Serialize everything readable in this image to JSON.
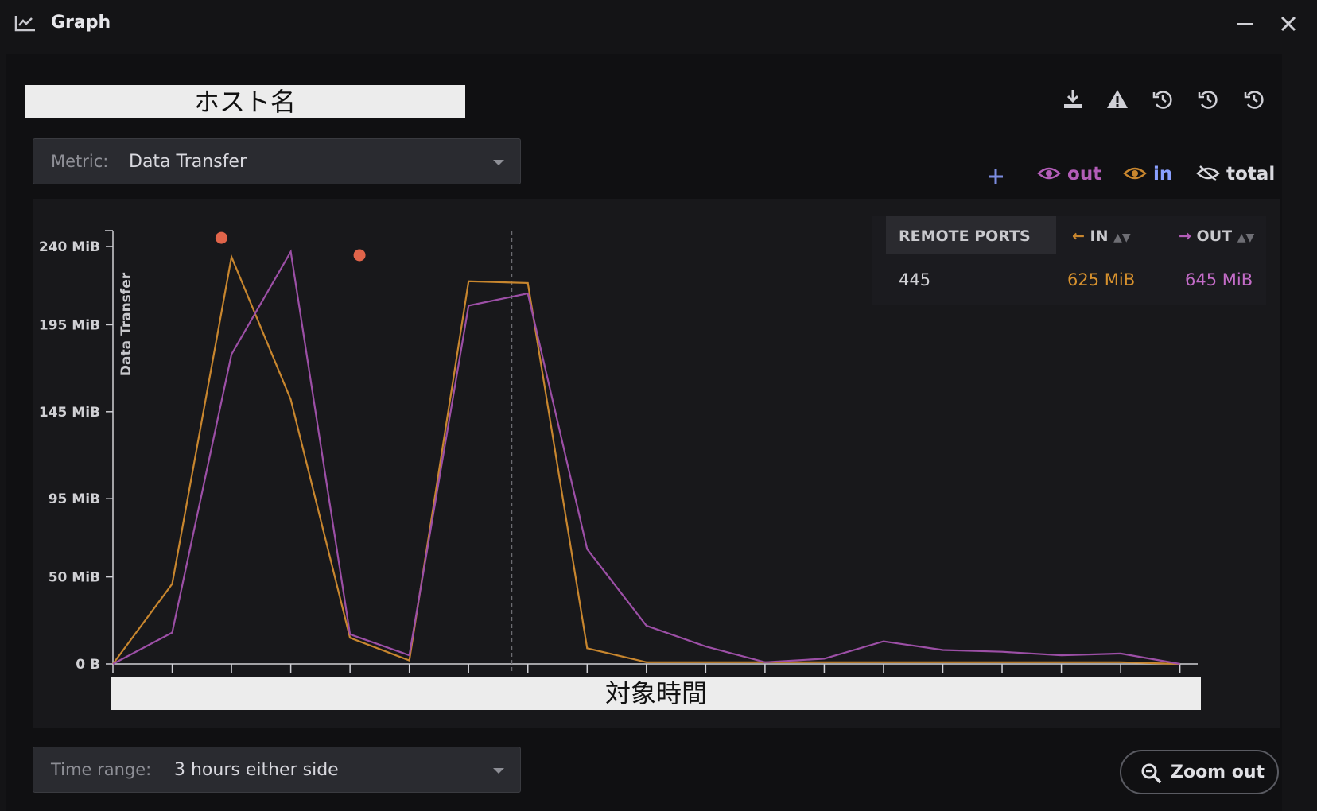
{
  "window": {
    "title": "Graph",
    "minimize_icon": "minimize-icon",
    "close_icon": "close-icon"
  },
  "header": {
    "host_label": "ホスト名"
  },
  "toolbar": {
    "icons": [
      "download-icon",
      "warning-icon",
      "history-icon",
      "history-icon",
      "history-icon"
    ]
  },
  "metric": {
    "label": "Metric:",
    "value": "Data Transfer"
  },
  "legend": {
    "add_icon": "plus-icon",
    "items": [
      {
        "label": "out",
        "icon": "eye-icon",
        "color": "#b35db8"
      },
      {
        "label": "in",
        "icon": "eye-icon",
        "color": "#c8862e"
      },
      {
        "label": "total",
        "icon": "eye-off-icon",
        "color": "#d8d8de"
      }
    ]
  },
  "ports_table": {
    "headers": {
      "ports": "REMOTE PORTS",
      "in": "IN",
      "out": "OUT"
    },
    "rows": [
      {
        "port": "445",
        "in": "625 MiB",
        "out": "645 MiB"
      }
    ]
  },
  "chart_data": {
    "type": "line",
    "ylabel": "Data Transfer",
    "xlabel": "対象時間",
    "ylim": [
      0,
      240
    ],
    "yticks": [
      {
        "value": 0,
        "label": "0 B"
      },
      {
        "value": 50,
        "label": "50 MiB"
      },
      {
        "value": 95,
        "label": "95 MiB"
      },
      {
        "value": 145,
        "label": "145 MiB"
      },
      {
        "value": 195,
        "label": "195 MiB"
      },
      {
        "value": 240,
        "label": "240 MiB"
      }
    ],
    "x": [
      0,
      1,
      2,
      3,
      4,
      5,
      6,
      7,
      8,
      9,
      10,
      11,
      12,
      13,
      14,
      15,
      16,
      17,
      18
    ],
    "xlim": [
      0,
      18.3
    ],
    "marker_x": 6.73,
    "series": [
      {
        "name": "in",
        "color": "#c8862e",
        "values": [
          0,
          46,
          234,
          152,
          15,
          2,
          220,
          219,
          9,
          1,
          1,
          1,
          1,
          1,
          1,
          1,
          1,
          1,
          0
        ]
      },
      {
        "name": "out",
        "color": "#9c4fa6",
        "values": [
          0,
          18,
          178,
          237,
          17,
          5,
          206,
          213,
          66,
          22,
          10,
          1,
          3,
          13,
          8,
          7,
          5,
          6,
          0
        ]
      }
    ],
    "alerts": [
      {
        "x": 1.83,
        "y": 245
      },
      {
        "x": 4.16,
        "y": 235
      }
    ],
    "alert_color": "#e0644a"
  },
  "time_range": {
    "label": "Time range:",
    "value": "3 hours either side"
  },
  "zoom": {
    "label": "Zoom out",
    "icon": "zoom-out-icon"
  }
}
